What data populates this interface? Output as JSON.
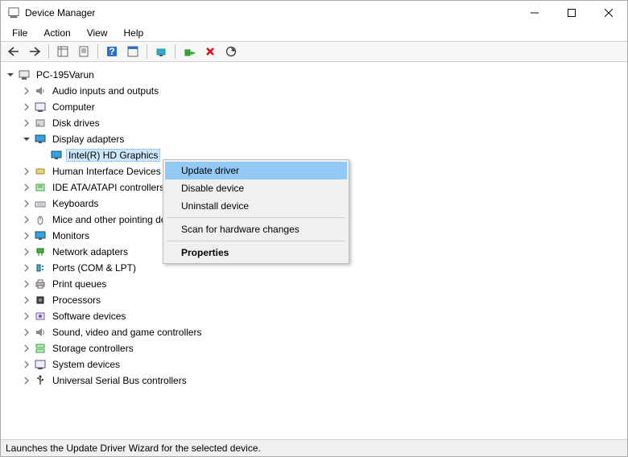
{
  "window": {
    "title": "Device Manager",
    "minimize_tooltip": "Minimize",
    "maximize_tooltip": "Maximize",
    "close_tooltip": "Close"
  },
  "menubar": {
    "file": "File",
    "action": "Action",
    "view": "View",
    "help": "Help"
  },
  "toolbar_icons": {
    "back": "back-icon",
    "forward": "forward-icon",
    "show_hide": "show-hide-tree-icon",
    "properties": "properties-icon",
    "help": "help-icon",
    "prop_sheet": "prop-sheet-icon",
    "update_driver": "update-driver-icon",
    "uninstall": "uninstall-icon",
    "disable": "disable-icon",
    "scan": "scan-hardware-icon"
  },
  "tree": {
    "root": "PC-195Varun",
    "categories": [
      {
        "label": "Audio inputs and outputs",
        "icon": "speaker-icon"
      },
      {
        "label": "Computer",
        "icon": "computer-icon"
      },
      {
        "label": "Disk drives",
        "icon": "disk-icon"
      },
      {
        "label": "Display adapters",
        "icon": "monitor-icon",
        "expanded": true,
        "children": [
          {
            "label": "Intel(R) HD Graphics",
            "icon": "monitor-icon",
            "selected": true
          }
        ]
      },
      {
        "label": "Human Interface Devices",
        "icon": "hid-icon"
      },
      {
        "label": "IDE ATA/ATAPI controllers",
        "icon": "ide-icon"
      },
      {
        "label": "Keyboards",
        "icon": "keyboard-icon"
      },
      {
        "label": "Mice and other pointing devices",
        "icon": "mouse-icon"
      },
      {
        "label": "Monitors",
        "icon": "monitor-icon"
      },
      {
        "label": "Network adapters",
        "icon": "network-icon"
      },
      {
        "label": "Ports (COM & LPT)",
        "icon": "port-icon"
      },
      {
        "label": "Print queues",
        "icon": "printer-icon"
      },
      {
        "label": "Processors",
        "icon": "cpu-icon"
      },
      {
        "label": "Software devices",
        "icon": "software-icon"
      },
      {
        "label": "Sound, video and game controllers",
        "icon": "sound-icon"
      },
      {
        "label": "Storage controllers",
        "icon": "storage-icon"
      },
      {
        "label": "System devices",
        "icon": "system-icon"
      },
      {
        "label": "Universal Serial Bus controllers",
        "icon": "usb-icon"
      }
    ]
  },
  "context_menu": {
    "items": [
      {
        "label": "Update driver",
        "hovered": true
      },
      {
        "label": "Disable device"
      },
      {
        "label": "Uninstall device"
      },
      {
        "separator": true
      },
      {
        "label": "Scan for hardware changes"
      },
      {
        "separator": true
      },
      {
        "label": "Properties",
        "bold": true
      }
    ]
  },
  "statusbar": {
    "text": "Launches the Update Driver Wizard for the selected device."
  }
}
